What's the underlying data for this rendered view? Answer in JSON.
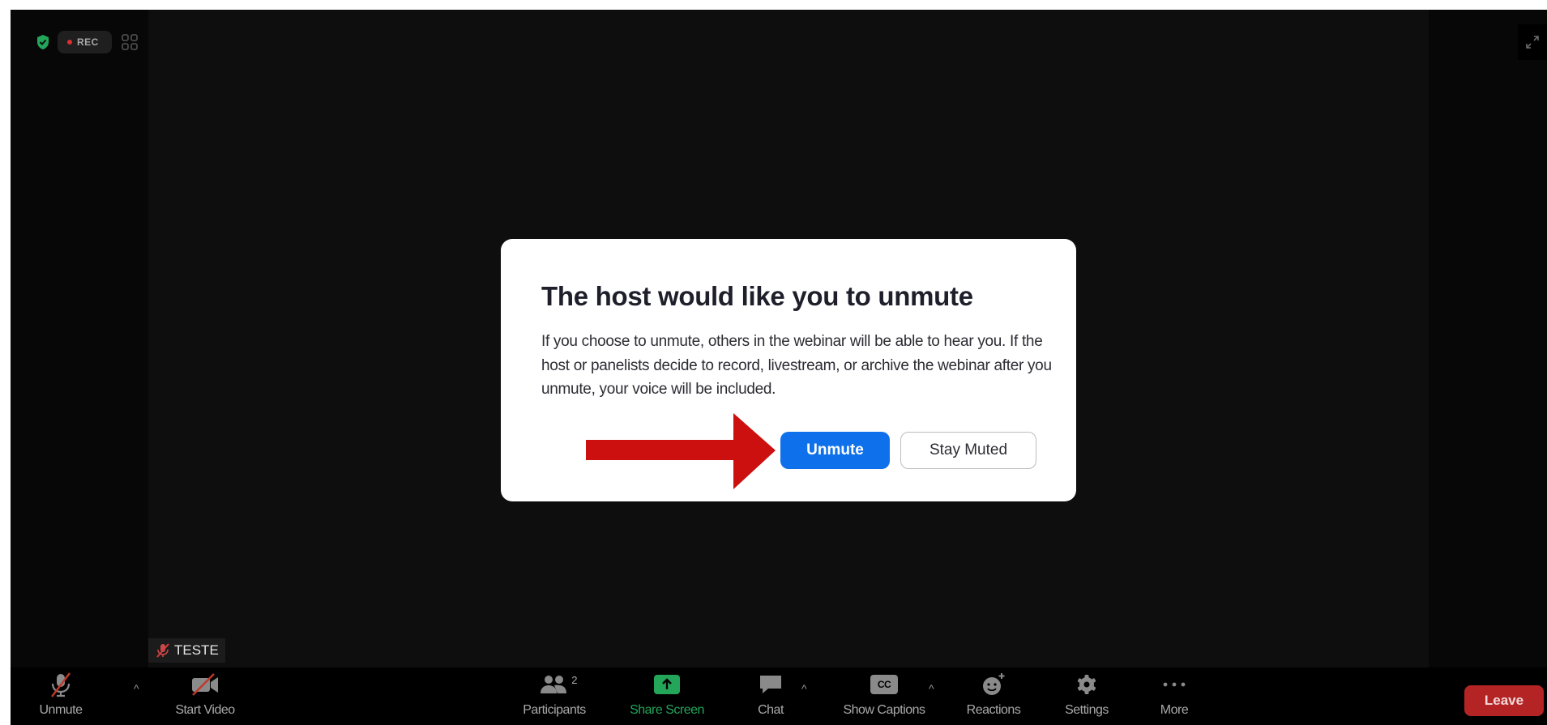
{
  "recording": {
    "label": "REC"
  },
  "participant": {
    "name": "TESTE"
  },
  "dialog": {
    "title": "The host would like you to unmute",
    "body": "If you choose to unmute, others in the webinar will be able to hear you. If the host or panelists decide to record, livestream, or archive the webinar after you unmute, your voice will be included.",
    "unmute_label": "Unmute",
    "stay_muted_label": "Stay Muted"
  },
  "toolbar": {
    "unmute_label": "Unmute",
    "start_video_label": "Start Video",
    "participants_label": "Participants",
    "participants_count": "2",
    "share_screen_label": "Share Screen",
    "chat_label": "Chat",
    "show_captions_label": "Show Captions",
    "captions_badge": "CC",
    "reactions_label": "Reactions",
    "settings_label": "Settings",
    "more_label": "More",
    "leave_label": "Leave"
  },
  "colors": {
    "accent_blue": "#0e71eb",
    "share_green": "#23a55a",
    "leave_red": "#b42424",
    "annotation_arrow": "#cc1010",
    "encryption_green": "#23a55a"
  }
}
